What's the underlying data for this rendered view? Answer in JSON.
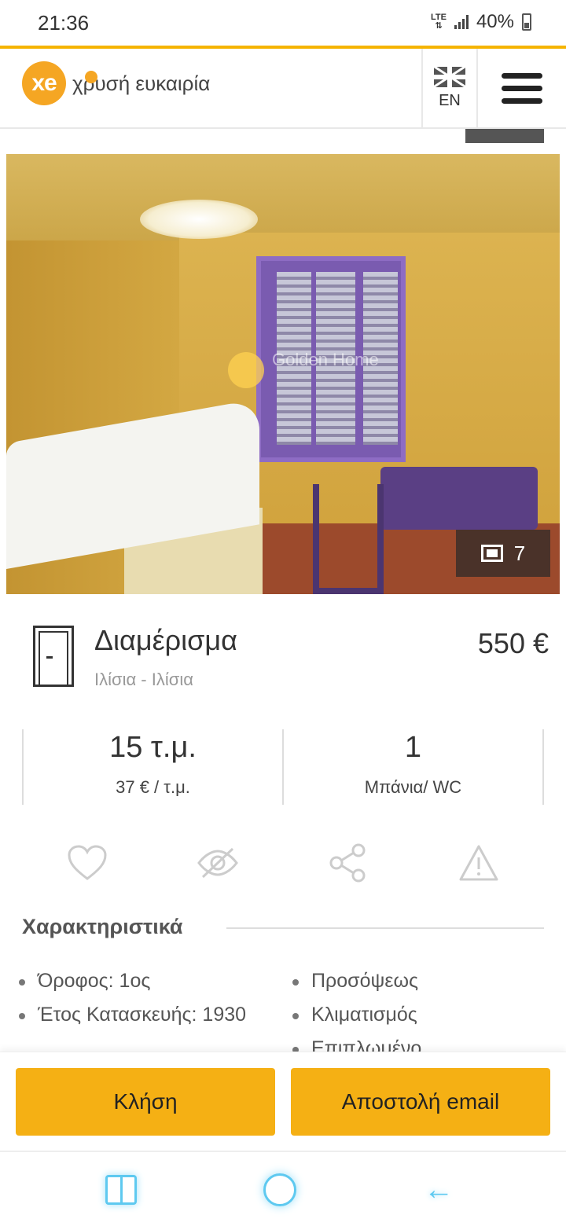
{
  "status_bar": {
    "time": "21:36",
    "network": "LTE",
    "battery": "40%"
  },
  "header": {
    "logo_mark": "xe",
    "logo_text": "χρυσή ευκαιρία",
    "language": "EN"
  },
  "photo": {
    "count": "7",
    "watermark": "Golden Home"
  },
  "listing": {
    "type": "Διαμέρισμα",
    "location": "Ιλίσια - Ιλίσια",
    "price": "550 €",
    "area": "15 τ.μ.",
    "price_per_sqm": "37 € / τ.μ.",
    "bathrooms": "1",
    "bathrooms_label": "Μπάνια/ WC"
  },
  "features": {
    "title": "Χαρακτηριστικά",
    "left": [
      "Όροφος: 1ος",
      "Έτος Κατασκευής: 1930"
    ],
    "right": [
      "Προσόψεως",
      "Κλιματισμός",
      "Επιπλωμένο"
    ]
  },
  "cta": {
    "call": "Κλήση",
    "email": "Αποστολή email"
  },
  "icons": {
    "favorite": "heart-icon",
    "hide": "eye-slash-icon",
    "share": "share-icon",
    "report": "warning-icon"
  },
  "colors": {
    "accent": "#f5b014",
    "logo": "#f5a623",
    "nav": "#5ec9f0"
  }
}
